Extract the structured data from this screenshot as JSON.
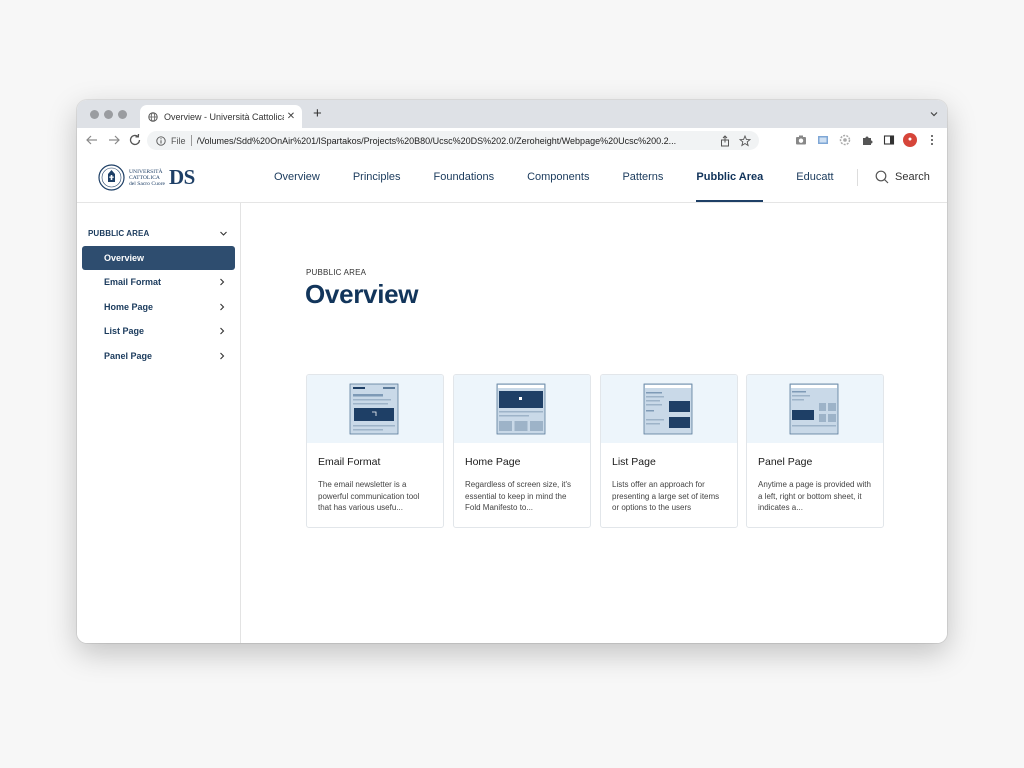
{
  "browser": {
    "tab_title": "Overview - Università Cattolica",
    "new_tab": "+",
    "close_tab": "✕",
    "file_label": "File",
    "url": "/Volumes/Sdd%20OnAir%201/lSpartakos/Projects%20B80/Ucsc%20DS%202.0/Zeroheight/Webpage%20Ucsc%200.2..."
  },
  "header": {
    "logo_line1": "UNIVERSITÀ",
    "logo_line2": "CATTOLICA",
    "logo_line3": "del Sacro Cuore",
    "logo_ds": "DS",
    "nav": [
      {
        "label": "Overview"
      },
      {
        "label": "Principles"
      },
      {
        "label": "Foundations"
      },
      {
        "label": "Components"
      },
      {
        "label": "Patterns"
      },
      {
        "label": "Pubblic Area",
        "active": true
      },
      {
        "label": "Educatt"
      }
    ],
    "search_label": "Search"
  },
  "sidebar": {
    "section": "PUBBLIC AREA",
    "items": [
      {
        "label": "Overview",
        "active": true
      },
      {
        "label": "Email Format"
      },
      {
        "label": "Home Page"
      },
      {
        "label": "List Page"
      },
      {
        "label": "Panel Page"
      }
    ]
  },
  "main": {
    "eyebrow": "PUBBLIC AREA",
    "title": "Overview",
    "cards": [
      {
        "title": "Email Format",
        "desc": "The email newsletter is a powerful communication tool that has various usefu..."
      },
      {
        "title": "Home Page",
        "desc": "Regardless of screen size, it's essential to keep in mind the Fold Manifesto to..."
      },
      {
        "title": "List Page",
        "desc": "Lists offer an approach for presenting a large set of items or options to the users"
      },
      {
        "title": "Panel Page",
        "desc": "Anytime a page is provided with a left, right or bottom sheet, it indicates a..."
      }
    ]
  },
  "colors": {
    "brand": "#1e3f66",
    "active_bg": "#2e4d6f",
    "thumb_bg": "#edf5fb"
  }
}
